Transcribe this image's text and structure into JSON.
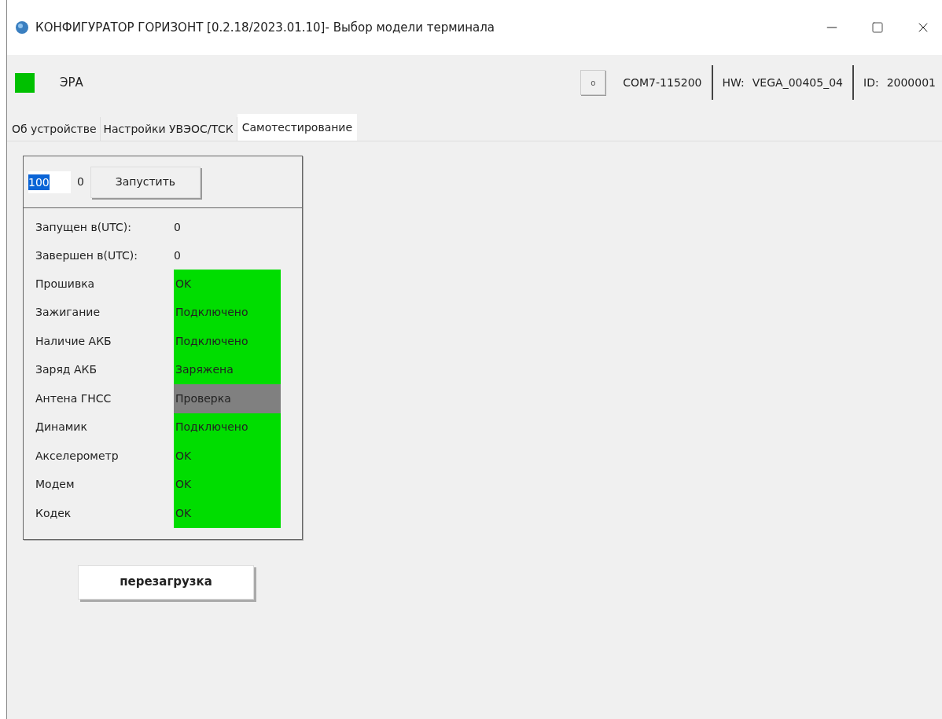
{
  "window": {
    "title": "КОНФИГУРАТОР ГОРИЗОНТ [0.2.18/2023.01.10]- Выбор модели терминала"
  },
  "header": {
    "indicator": {
      "color": "#00c000"
    },
    "device": "ЭРА",
    "button": "o",
    "port": "COM7-115200",
    "hw_label": "HW:",
    "hw": "VEGA_00405_04",
    "id_label": "ID:",
    "id": "2000001"
  },
  "tabs": [
    {
      "label": "Об устройстве",
      "selected": false
    },
    {
      "label": "Настройки УВЭОС/ТСК",
      "selected": false
    },
    {
      "label": "Самотестирование",
      "selected": true
    }
  ],
  "selftest": {
    "count_field": {
      "value": "100"
    },
    "count_suffix": "0",
    "run_button": "Запустить",
    "started_label": "Запущен в(UTC):",
    "started": "0",
    "finished_label": "Завершен в(UTC):",
    "finished": "0",
    "checks": [
      {
        "name": "Прошивка",
        "status": "OK",
        "color": "#00dd00"
      },
      {
        "name": "Зажигание",
        "status": "Подключено",
        "color": "#00dd00"
      },
      {
        "name": "Наличие АКБ",
        "status": "Подключено",
        "color": "#00dd00"
      },
      {
        "name": "Заряд АКБ",
        "status": "Заряжена",
        "color": "#00dd00"
      },
      {
        "name": "Антена ГНСС",
        "status": "Проверка",
        "color": "#808080"
      },
      {
        "name": "Динамик",
        "status": "Подключено",
        "color": "#00dd00"
      },
      {
        "name": "Акселерометр",
        "status": "OK",
        "color": "#00dd00"
      },
      {
        "name": "Модем",
        "status": "OK",
        "color": "#00dd00"
      },
      {
        "name": "Кодек",
        "status": "OK",
        "color": "#00dd00"
      }
    ]
  },
  "reboot_button": "перезагрузка"
}
